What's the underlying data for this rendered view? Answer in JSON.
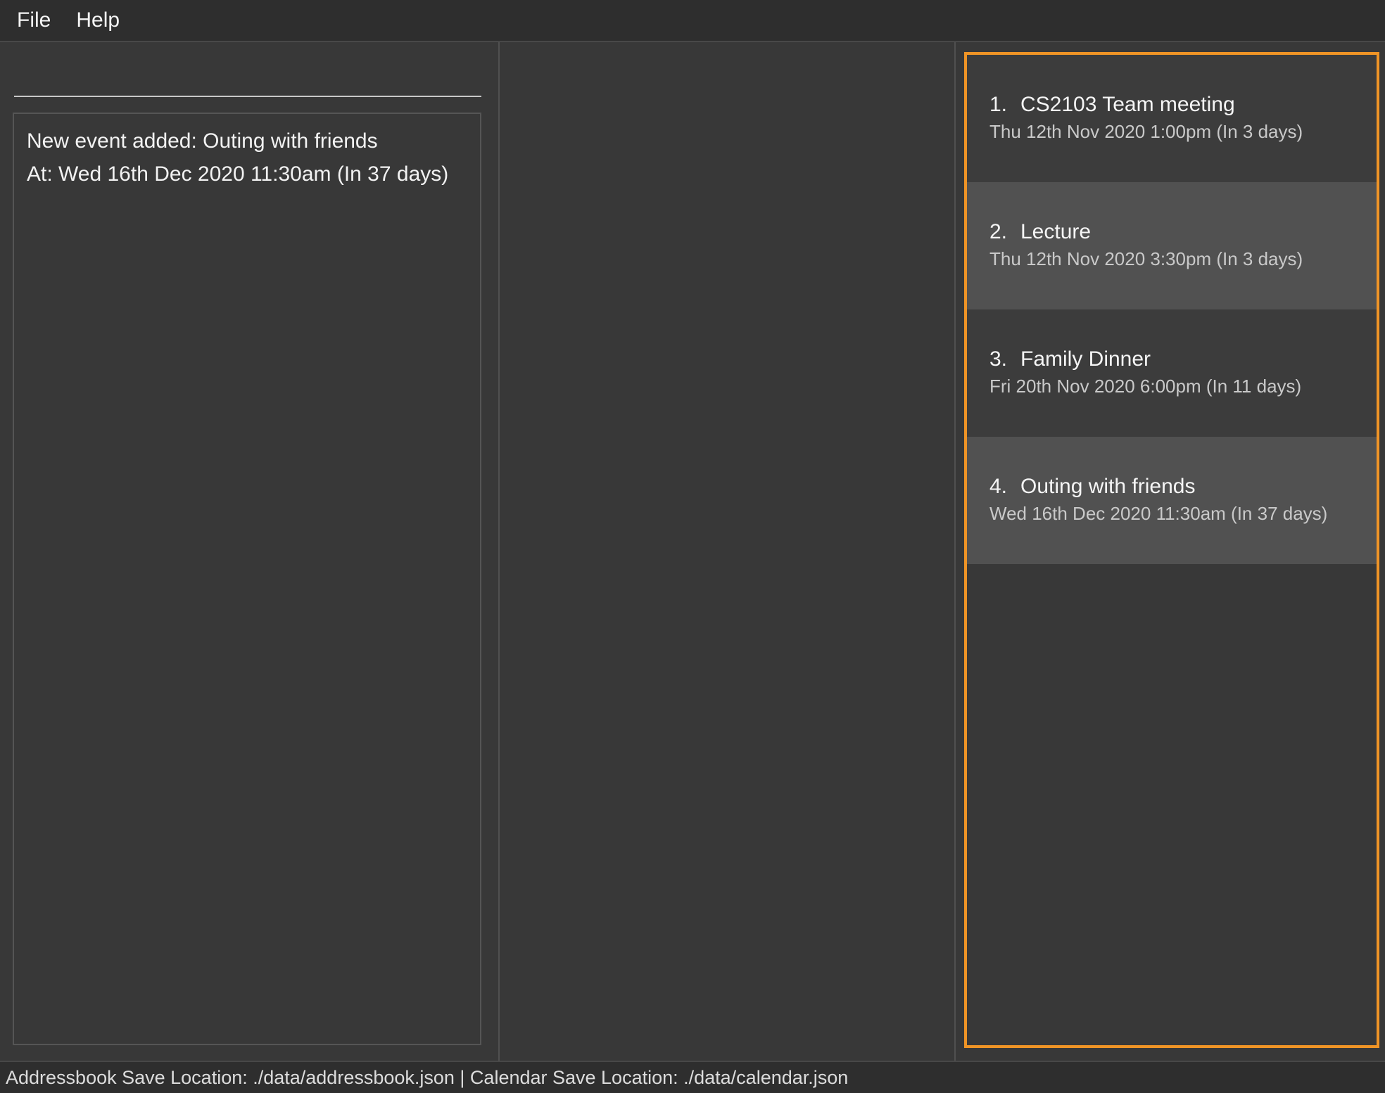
{
  "menubar": {
    "file": "File",
    "help": "Help"
  },
  "left": {
    "command_value": "",
    "result_text": "New event added: Outing with friends\nAt: Wed 16th Dec 2020 11:30am (In 37 days)"
  },
  "events": [
    {
      "index": "1.",
      "title": "CS2103 Team meeting",
      "time": "Thu 12th Nov 2020 1:00pm (In 3 days)"
    },
    {
      "index": "2.",
      "title": "Lecture",
      "time": "Thu 12th Nov 2020 3:30pm (In 3 days)"
    },
    {
      "index": "3.",
      "title": "Family Dinner",
      "time": "Fri 20th Nov 2020 6:00pm (In 11 days)"
    },
    {
      "index": "4.",
      "title": "Outing with friends",
      "time": "Wed 16th Dec 2020 11:30am (In 37 days)"
    }
  ],
  "statusbar": {
    "text": "Addressbook Save Location: ./data/addressbook.json | Calendar Save Location: ./data/calendar.json"
  }
}
